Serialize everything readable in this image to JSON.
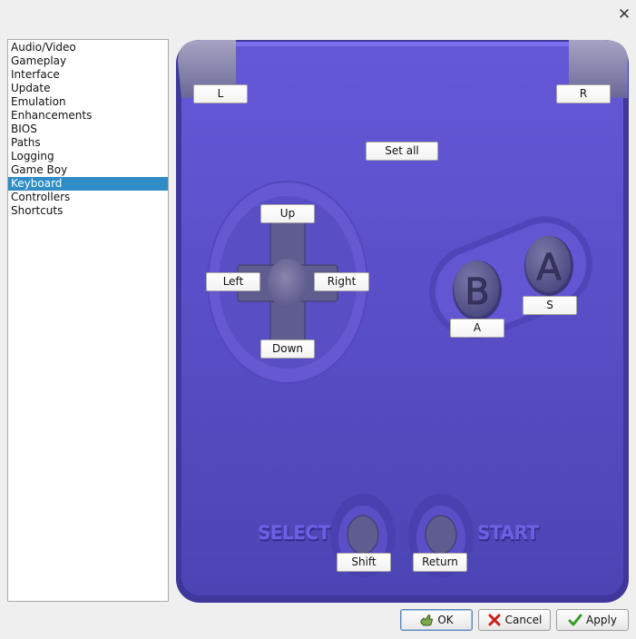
{
  "window": {
    "close_glyph": "✕"
  },
  "categories": [
    {
      "label": "Audio/Video",
      "selected": false
    },
    {
      "label": "Gameplay",
      "selected": false
    },
    {
      "label": "Interface",
      "selected": false
    },
    {
      "label": "Update",
      "selected": false
    },
    {
      "label": "Emulation",
      "selected": false
    },
    {
      "label": "Enhancements",
      "selected": false
    },
    {
      "label": "BIOS",
      "selected": false
    },
    {
      "label": "Paths",
      "selected": false
    },
    {
      "label": "Logging",
      "selected": false
    },
    {
      "label": "Game Boy",
      "selected": false
    },
    {
      "label": "Keyboard",
      "selected": true
    },
    {
      "label": "Controllers",
      "selected": false
    },
    {
      "label": "Shortcuts",
      "selected": false
    }
  ],
  "pad": {
    "set_all_label": "Set all",
    "bindings": {
      "l": "L",
      "r": "R",
      "up": "Up",
      "left": "Left",
      "right": "Right",
      "down": "Down",
      "a": "A",
      "b": "S",
      "select": "Shift",
      "start": "Return"
    },
    "face_a_letter": "A",
    "face_b_letter": "B",
    "select_text": "SELECT",
    "start_text": "START",
    "body_color": "#5a4fc8",
    "accent_color": "#6a5fe0"
  },
  "dialog": {
    "ok_label": "OK",
    "cancel_label": "Cancel",
    "apply_label": "Apply",
    "ok_icon": "ok-hand-icon",
    "cancel_icon": "red-x-icon",
    "apply_icon": "green-check-icon"
  }
}
